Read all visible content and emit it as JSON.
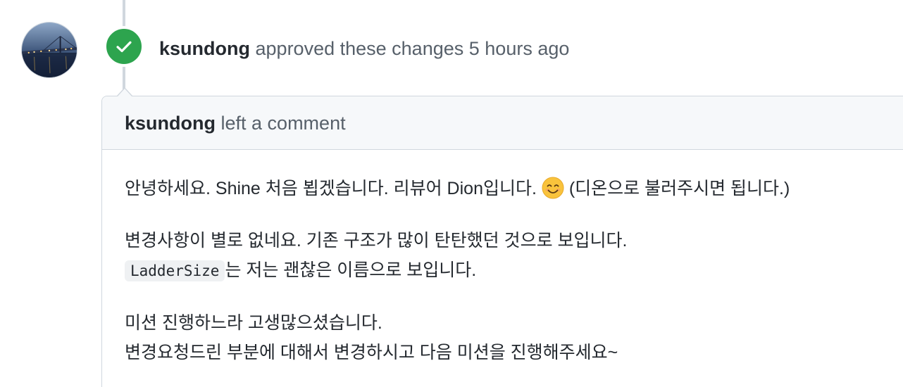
{
  "review": {
    "author": "ksundong",
    "action": "approved these changes",
    "time": "5 hours ago",
    "badge_color": "#2da44e",
    "badge_icon": "check-icon"
  },
  "comment": {
    "author": "ksundong",
    "action": "left a comment",
    "paragraph1_text": "안녕하세요. Shine 처음 뵙겠습니다. 리뷰어 Dion입니다.",
    "paragraph1_emoji": "smiling-face-emoji",
    "paragraph1_suffix": "(디온으로 불러주시면 됩니다.)",
    "paragraph2_line1": "변경사항이 별로 없네요. 기존 구조가 많이 탄탄했던 것으로 보입니다.",
    "paragraph2_code": "LadderSize",
    "paragraph2_line2": "는 저는 괜찮은 이름으로 보입니다.",
    "paragraph3_line1": "미션 진행하느라 고생많으셨습니다.",
    "paragraph3_line2": "변경요청드린 부분에 대해서 변경하시고 다음 미션을 진행해주세요~"
  },
  "colors": {
    "border": "#d0d7de",
    "header_bg": "#f6f8fa",
    "muted_text": "#57606a",
    "text": "#24292f"
  }
}
